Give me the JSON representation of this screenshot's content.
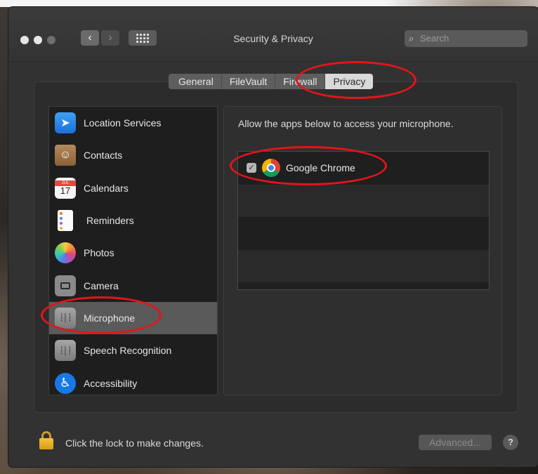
{
  "window": {
    "title": "Security & Privacy",
    "search_placeholder": "Search",
    "back_label": "‹",
    "forward_label": "›"
  },
  "tabs": [
    {
      "label": "General",
      "selected": false
    },
    {
      "label": "FileVault",
      "selected": false
    },
    {
      "label": "Firewall",
      "selected": false
    },
    {
      "label": "Privacy",
      "selected": true
    }
  ],
  "sidebar": {
    "items": [
      {
        "label": "Location Services",
        "icon": "location-arrow-icon",
        "selected": false
      },
      {
        "label": "Contacts",
        "icon": "contacts-book-icon",
        "selected": false
      },
      {
        "label": "Calendars",
        "icon": "calendar-icon",
        "selected": false
      },
      {
        "label": "Reminders",
        "icon": "reminders-list-icon",
        "selected": false
      },
      {
        "label": "Photos",
        "icon": "photos-flower-icon",
        "selected": false
      },
      {
        "label": "Camera",
        "icon": "camera-icon",
        "selected": false
      },
      {
        "label": "Microphone",
        "icon": "microphone-waveform-icon",
        "selected": true
      },
      {
        "label": "Speech Recognition",
        "icon": "speech-waveform-icon",
        "selected": false
      },
      {
        "label": "Accessibility",
        "icon": "accessibility-person-icon",
        "selected": false
      }
    ],
    "calendar_month": "JUL",
    "calendar_day": "17"
  },
  "main": {
    "description": "Allow the apps below to access your microphone.",
    "apps": [
      {
        "name": "Google Chrome",
        "checked": true,
        "icon": "chrome-icon"
      }
    ]
  },
  "footer": {
    "lock_text": "Click the lock to make changes.",
    "advanced_label": "Advanced...",
    "help_label": "?"
  },
  "colors": {
    "annotation": "#e5141a",
    "selected_row": "#5a5a5a",
    "window_bg": "#323232"
  }
}
